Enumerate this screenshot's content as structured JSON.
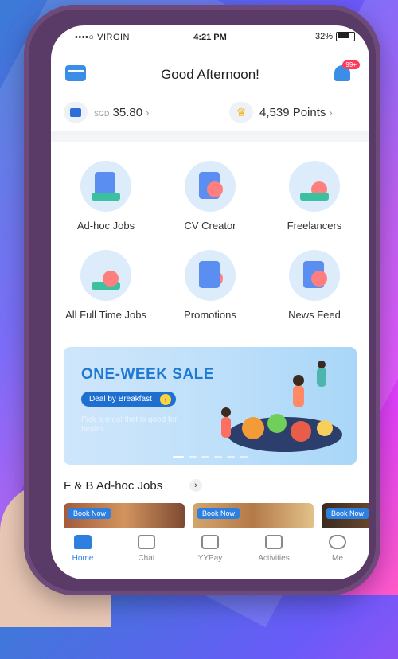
{
  "status_bar": {
    "carrier": "••••○ VIRGIN",
    "time": "4:21 PM",
    "battery": "32%"
  },
  "header": {
    "title": "Good Afternoon!",
    "notification_count": "99+"
  },
  "balance": {
    "currency": "SGD",
    "amount": "35.80",
    "points": "4,539 Points"
  },
  "services": [
    {
      "label": "Ad-hoc Jobs",
      "icon": "adhoc-jobs-icon"
    },
    {
      "label": "CV Creator",
      "icon": "cv-creator-icon"
    },
    {
      "label": "Freelancers",
      "icon": "freelancers-icon"
    },
    {
      "label": "All Full Time Jobs",
      "icon": "fulltime-jobs-icon"
    },
    {
      "label": "Promotions",
      "icon": "promotions-icon"
    },
    {
      "label": "News Feed",
      "icon": "news-feed-icon"
    }
  ],
  "banner": {
    "title": "ONE-WEEK SALE",
    "button": "Deal by Breakfast",
    "subtitle": "Pick a meal that is good for health"
  },
  "section": {
    "title": "F & B Ad-hoc Jobs"
  },
  "job_cards": [
    {
      "badge": "Book Now"
    },
    {
      "badge": "Book Now"
    },
    {
      "badge": "Book Now"
    }
  ],
  "tabs": [
    {
      "label": "Home",
      "active": true
    },
    {
      "label": "Chat",
      "active": false
    },
    {
      "label": "YYPay",
      "active": false
    },
    {
      "label": "Activities",
      "active": false
    },
    {
      "label": "Me",
      "active": false
    }
  ],
  "colors": {
    "accent": "#2d7fe0",
    "banner_title": "#1f78d1",
    "badge": "#ff3b5c"
  }
}
